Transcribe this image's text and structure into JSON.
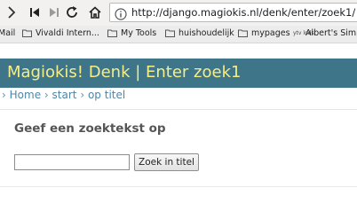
{
  "browser": {
    "url": "http://django.magiokis.nl/denk/enter/zoek1/"
  },
  "bookmarks": [
    {
      "label": "Mail",
      "icon": "none"
    },
    {
      "label": "Vivaldi Intern...",
      "icon": "folder-icon"
    },
    {
      "label": "My Tools",
      "icon": "folder-icon"
    },
    {
      "label": "huishoudelijk",
      "icon": "folder-icon"
    },
    {
      "label": "mypages",
      "icon": "folder-icon"
    },
    {
      "label": "Albert's Simp",
      "icon": "ytv-icon"
    }
  ],
  "bookmark_ytv_text": "ytv lods",
  "page": {
    "banner_title": "Magiokis! Denk | Enter zoek1",
    "breadcrumb": {
      "lead_sep": "›",
      "home": "Home",
      "sep1": "›",
      "start": "start",
      "sep2": "›",
      "current": "op titel"
    },
    "heading": "Geef een zoektekst op",
    "search": {
      "value": "",
      "button_label": "Zoek in titel"
    }
  },
  "colors": {
    "banner_bg": "#3f7589",
    "banner_text": "#f4ee8a",
    "link": "#4e86a8"
  }
}
